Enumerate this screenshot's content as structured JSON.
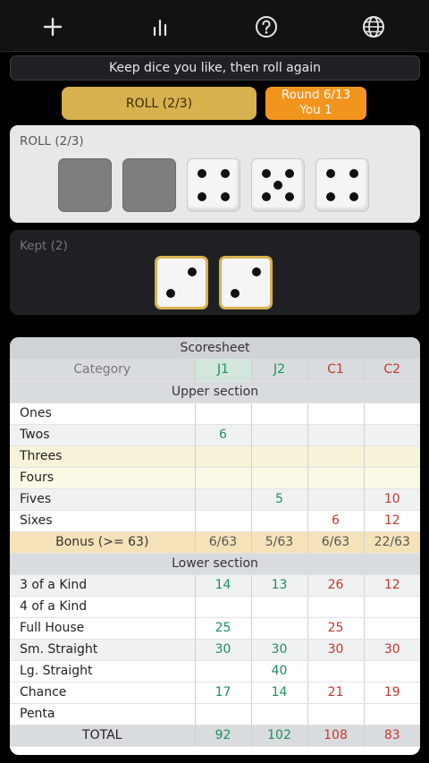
{
  "hint": "Keep dice you like, then roll again",
  "roll_button": "ROLL (2/3)",
  "round": {
    "line1": "Round 6/13",
    "line2": "You 1"
  },
  "roll_panel": {
    "title": "ROLL (2/3)"
  },
  "kept_panel": {
    "title": "Kept (2)"
  },
  "dice_rolled": [
    null,
    null,
    4,
    5,
    4
  ],
  "dice_kept": [
    2,
    2
  ],
  "sheet": {
    "title": "Scoresheet",
    "headers": [
      "Category",
      "J1",
      "J2",
      "C1",
      "C2"
    ],
    "upper_label": "Upper section",
    "lower_label": "Lower section",
    "upper": [
      {
        "cat": "Ones",
        "v": [
          "",
          "",
          "",
          ""
        ]
      },
      {
        "cat": "Twos",
        "v": [
          "6",
          "",
          "",
          ""
        ]
      },
      {
        "cat": "Threes",
        "v": [
          "",
          "",
          "",
          ""
        ]
      },
      {
        "cat": "Fours",
        "v": [
          "",
          "",
          "",
          ""
        ]
      },
      {
        "cat": "Fives",
        "v": [
          "",
          "5",
          "",
          "10"
        ]
      },
      {
        "cat": "Sixes",
        "v": [
          "",
          "",
          "6",
          "12"
        ]
      }
    ],
    "bonus": {
      "cat": "Bonus (>= 63)",
      "v": [
        "6/63",
        "5/63",
        "6/63",
        "22/63"
      ]
    },
    "lower": [
      {
        "cat": "3 of a Kind",
        "v": [
          "14",
          "13",
          "26",
          "12"
        ]
      },
      {
        "cat": "4 of a Kind",
        "v": [
          "",
          "",
          "",
          ""
        ]
      },
      {
        "cat": "Full House",
        "v": [
          "25",
          "",
          "25",
          ""
        ]
      },
      {
        "cat": "Sm. Straight",
        "v": [
          "30",
          "30",
          "30",
          "30"
        ]
      },
      {
        "cat": "Lg. Straight",
        "v": [
          "",
          "40",
          "",
          ""
        ]
      },
      {
        "cat": "Chance",
        "v": [
          "17",
          "14",
          "21",
          "19"
        ]
      },
      {
        "cat": "Penta",
        "v": [
          "",
          "",
          "",
          ""
        ]
      }
    ],
    "total": {
      "cat": "TOTAL",
      "v": [
        "92",
        "102",
        "108",
        "83"
      ]
    }
  },
  "icons": [
    "plus-icon",
    "bar-chart-icon",
    "help-icon",
    "globe-icon"
  ]
}
